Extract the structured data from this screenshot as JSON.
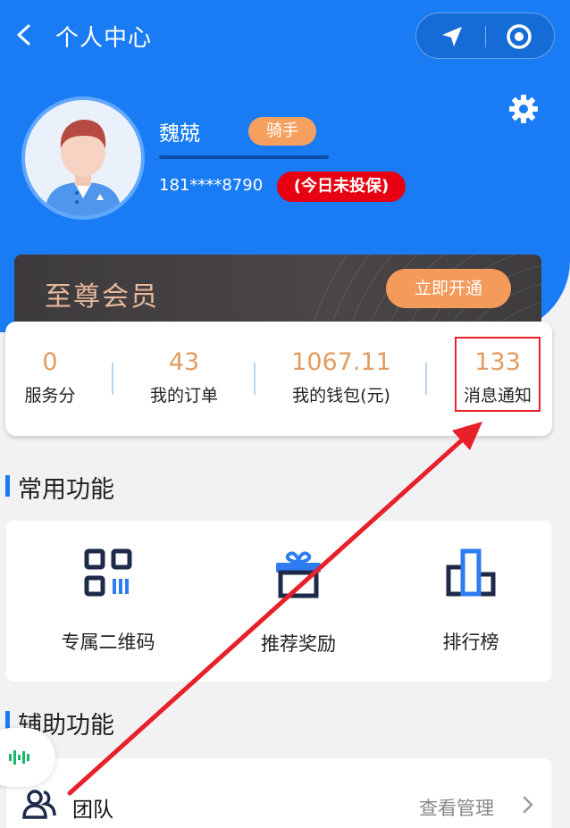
{
  "header": {
    "title": "个人中心",
    "back_icon": "chevron-left-icon",
    "capsule": {
      "left_icon": "navigation-arrow-icon",
      "right_icon": "target-icon"
    },
    "settings_icon": "gear-icon"
  },
  "user": {
    "name": "魏兢",
    "role": "骑手",
    "phone": "181****8790",
    "insurance_status": "(今日未投保)"
  },
  "vip": {
    "title": "至尊会员",
    "button": "立即开通"
  },
  "stats": [
    {
      "value": "0",
      "label": "服务分"
    },
    {
      "value": "43",
      "label": "我的订单"
    },
    {
      "value": "1067.11",
      "label": "我的钱包(元)"
    },
    {
      "value": "133",
      "label": "消息通知"
    }
  ],
  "common_functions": {
    "title": "常用功能",
    "items": [
      {
        "label": "专属二维码",
        "icon": "qr-code-icon"
      },
      {
        "label": "推荐奖励",
        "icon": "gift-icon"
      },
      {
        "label": "排行榜",
        "icon": "leaderboard-icon"
      }
    ]
  },
  "aux_functions": {
    "title": "辅助功能",
    "rows": [
      {
        "label": "团队",
        "action": "查看管理",
        "icon": "team-icon"
      }
    ]
  },
  "colors": {
    "primary_blue": "#1a7cf5",
    "stat_orange": "#e39b5f",
    "vip_button": "#f49a5b",
    "badge_red": "#e60012",
    "annotation_red": "#e8202a"
  }
}
